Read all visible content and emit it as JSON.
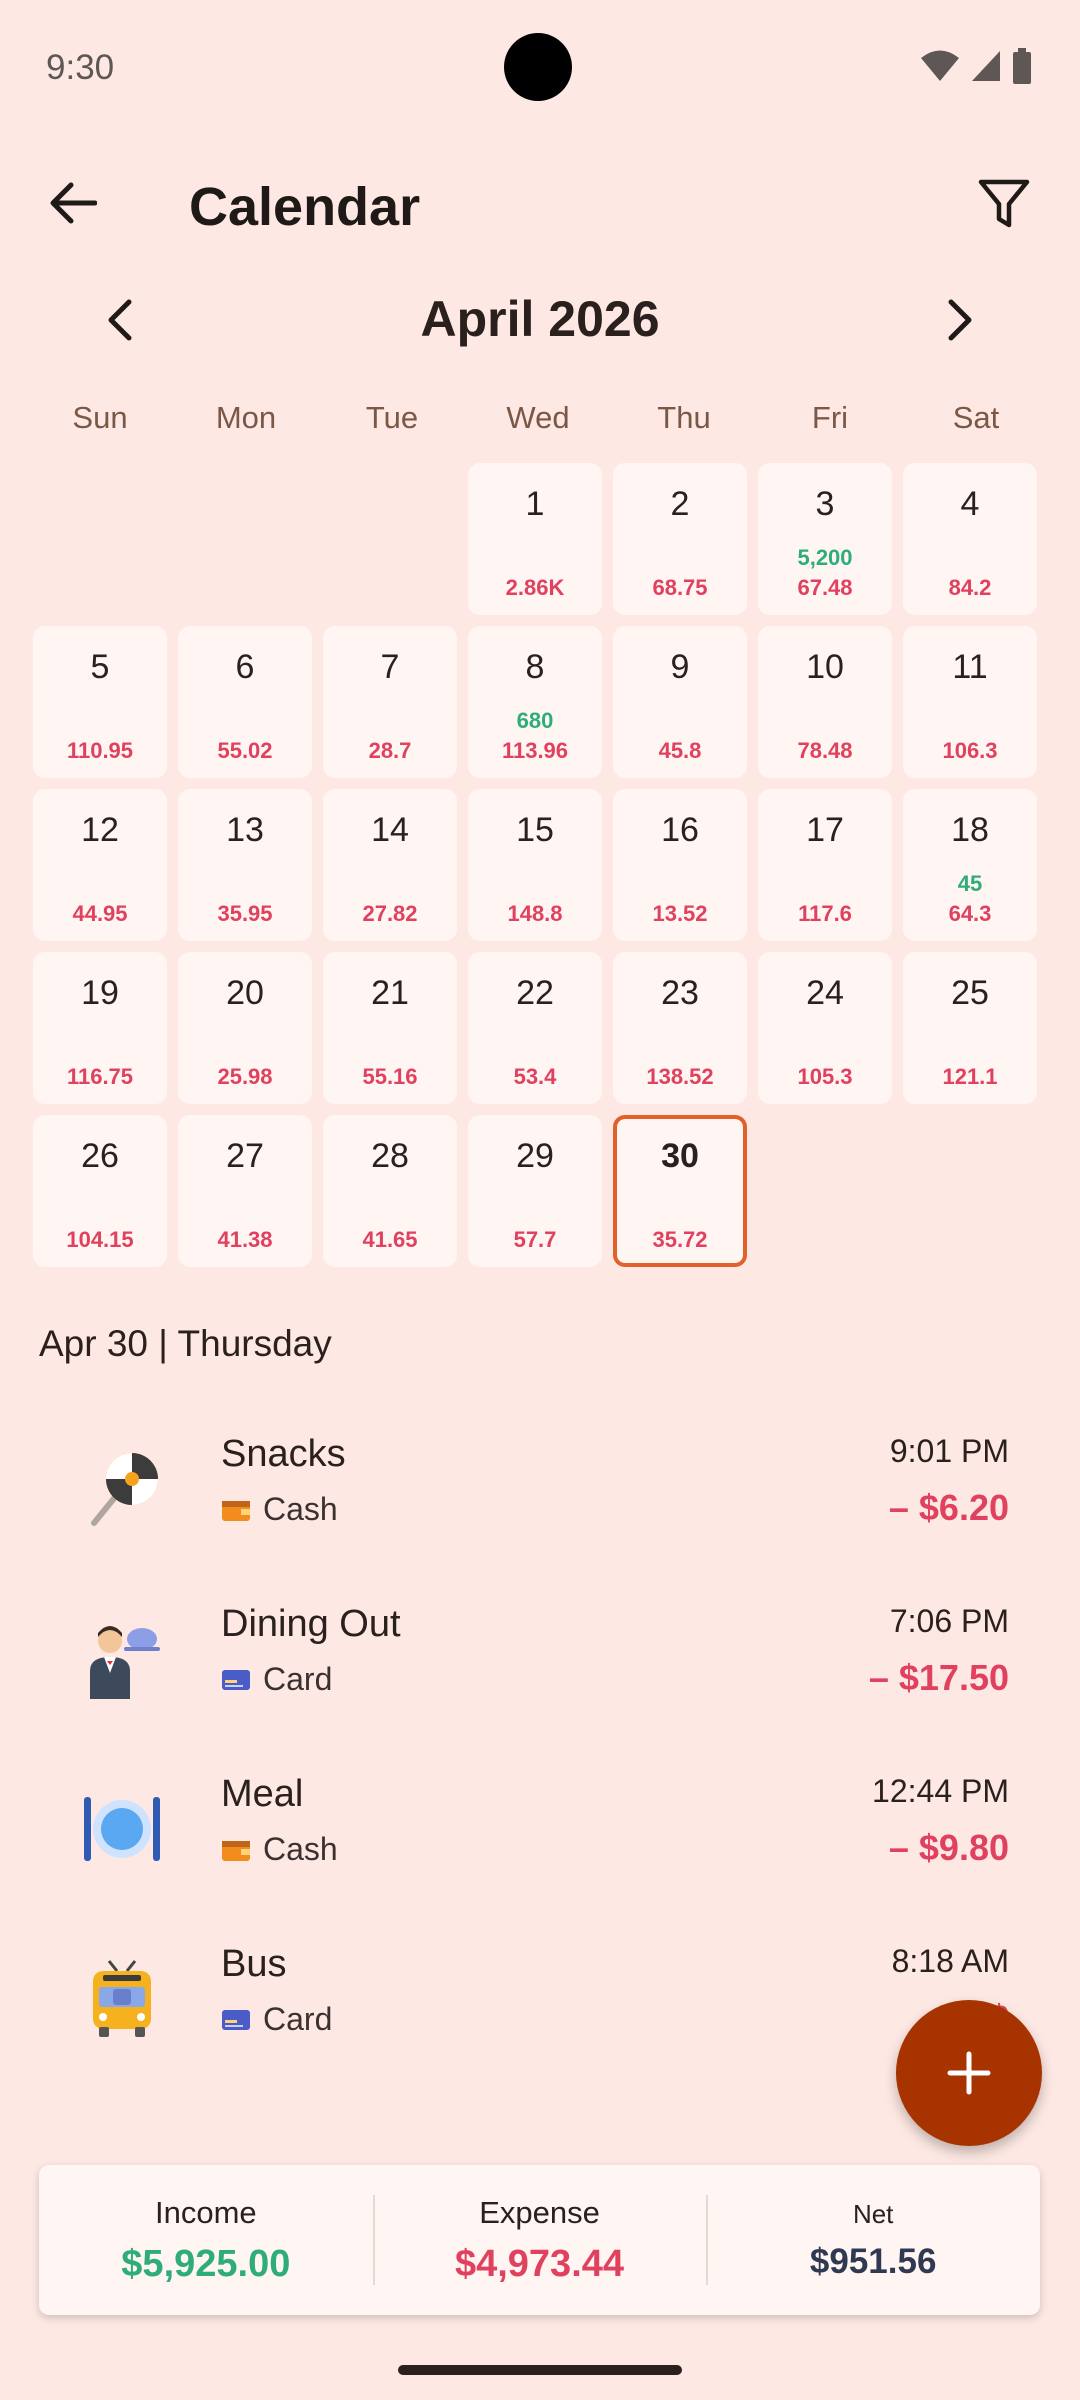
{
  "status_bar": {
    "time": "9:30"
  },
  "header": {
    "title": "Calendar"
  },
  "month": {
    "label": "April 2026"
  },
  "weekdays": [
    "Sun",
    "Mon",
    "Tue",
    "Wed",
    "Thu",
    "Fri",
    "Sat"
  ],
  "calendar": {
    "days": [
      {
        "day": "",
        "income": "",
        "expense": ""
      },
      {
        "day": "",
        "income": "",
        "expense": ""
      },
      {
        "day": "",
        "income": "",
        "expense": ""
      },
      {
        "day": "1",
        "income": "",
        "expense": "2.86K"
      },
      {
        "day": "2",
        "income": "",
        "expense": "68.75"
      },
      {
        "day": "3",
        "income": "5,200",
        "expense": "67.48"
      },
      {
        "day": "4",
        "income": "",
        "expense": "84.2"
      },
      {
        "day": "5",
        "income": "",
        "expense": "110.95"
      },
      {
        "day": "6",
        "income": "",
        "expense": "55.02"
      },
      {
        "day": "7",
        "income": "",
        "expense": "28.7"
      },
      {
        "day": "8",
        "income": "680",
        "expense": "113.96"
      },
      {
        "day": "9",
        "income": "",
        "expense": "45.8"
      },
      {
        "day": "10",
        "income": "",
        "expense": "78.48"
      },
      {
        "day": "11",
        "income": "",
        "expense": "106.3"
      },
      {
        "day": "12",
        "income": "",
        "expense": "44.95"
      },
      {
        "day": "13",
        "income": "",
        "expense": "35.95"
      },
      {
        "day": "14",
        "income": "",
        "expense": "27.82"
      },
      {
        "day": "15",
        "income": "",
        "expense": "148.8"
      },
      {
        "day": "16",
        "income": "",
        "expense": "13.52"
      },
      {
        "day": "17",
        "income": "",
        "expense": "117.6"
      },
      {
        "day": "18",
        "income": "45",
        "expense": "64.3"
      },
      {
        "day": "19",
        "income": "",
        "expense": "116.75"
      },
      {
        "day": "20",
        "income": "",
        "expense": "25.98"
      },
      {
        "day": "21",
        "income": "",
        "expense": "55.16"
      },
      {
        "day": "22",
        "income": "",
        "expense": "53.4"
      },
      {
        "day": "23",
        "income": "",
        "expense": "138.52"
      },
      {
        "day": "24",
        "income": "",
        "expense": "105.3"
      },
      {
        "day": "25",
        "income": "",
        "expense": "121.1"
      },
      {
        "day": "26",
        "income": "",
        "expense": "104.15"
      },
      {
        "day": "27",
        "income": "",
        "expense": "41.38"
      },
      {
        "day": "28",
        "income": "",
        "expense": "41.65"
      },
      {
        "day": "29",
        "income": "",
        "expense": "57.7"
      },
      {
        "day": "30",
        "income": "",
        "expense": "35.72",
        "today": true
      }
    ]
  },
  "selected_date": {
    "label": "Apr 30 | Thursday"
  },
  "transactions": [
    {
      "title": "Snacks",
      "method": "Cash",
      "time": "9:01 PM",
      "amount": "– $6.20",
      "icon": "lollipop-icon",
      "method_icon": "wallet-icon"
    },
    {
      "title": "Dining Out",
      "method": "Card",
      "time": "7:06 PM",
      "amount": "– $17.50",
      "icon": "waiter-icon",
      "method_icon": "credit-card-icon"
    },
    {
      "title": "Meal",
      "method": "Cash",
      "time": "12:44 PM",
      "amount": "– $9.80",
      "icon": "plate-cutlery-icon",
      "method_icon": "wallet-icon"
    },
    {
      "title": "Bus",
      "method": "Card",
      "time": "8:18 AM",
      "amount": "– $",
      "icon": "bus-icon",
      "method_icon": "credit-card-icon"
    }
  ],
  "summary": {
    "income_label": "Income",
    "income_value": "$5,925.00",
    "expense_label": "Expense",
    "expense_value": "$4,973.44",
    "net_label": "Net",
    "net_value": "$951.56"
  },
  "colors": {
    "background": "#FDE8E3",
    "cell": "#FFF5F3",
    "income": "#2EAD7B",
    "expense": "#E0415E",
    "today_border": "#E2612B",
    "fab": "#A63300",
    "net": "#2F3A52"
  }
}
